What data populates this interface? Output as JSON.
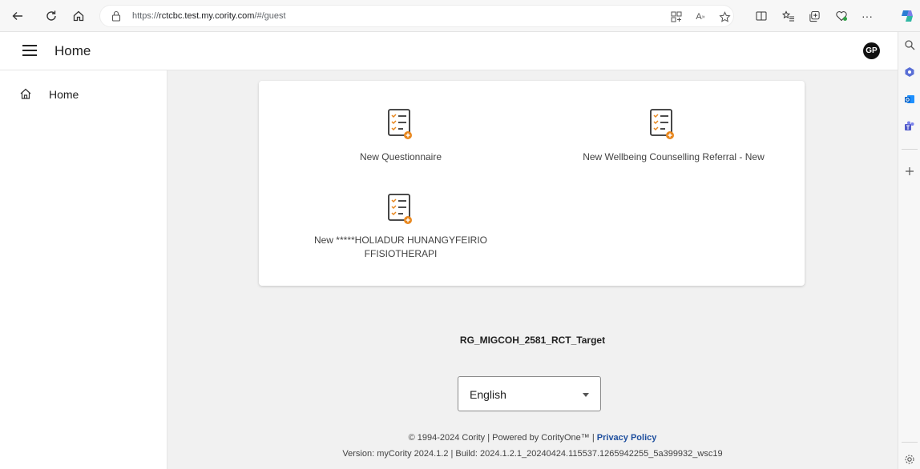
{
  "browser": {
    "url_prefix": "https://",
    "url_host": "rctcbc.test.my.cority.com",
    "url_path": "/#/guest"
  },
  "header": {
    "title": "Home",
    "avatar_initials": "GP"
  },
  "nav": {
    "items": [
      {
        "label": "Home",
        "icon": "home-icon"
      }
    ]
  },
  "tiles": [
    {
      "label": "New Questionnaire",
      "icon": "checklist-add-icon"
    },
    {
      "label": "New Wellbeing Counselling Referral - New",
      "icon": "checklist-add-icon"
    },
    {
      "label_line1": "New *****HOLIADUR HUNANGYFEIRIO",
      "label_line2": "FFISIOTHERAPI",
      "icon": "checklist-add-icon"
    }
  ],
  "site_name": "RG_MIGCOH_2581_RCT_Target",
  "language": {
    "selected": "English"
  },
  "footer": {
    "copyright": "© 1994-2024 Cority | Powered by CorityOne™ | ",
    "privacy_label": "Privacy Policy",
    "version": "Version: myCority 2024.1.2 | Build: 2024.1.2.1_20240424.115537.1265942255_5a399932_wsc19"
  },
  "colors": {
    "accent_orange": "#e8871e",
    "link_blue": "#1f4f9e",
    "page_bg": "#f1f1f1"
  }
}
